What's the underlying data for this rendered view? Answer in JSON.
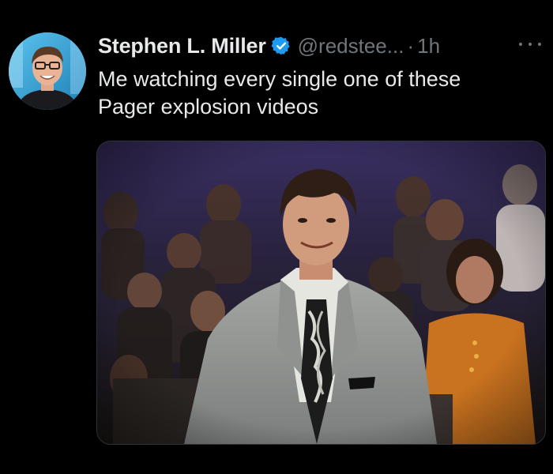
{
  "tweet": {
    "display_name": "Stephen L. Miller",
    "verified_icon": "verified-badge-icon",
    "handle": "@redstee...",
    "separator": "·",
    "timestamp": "1h",
    "more_icon": "more-options-icon",
    "text_lines": [
      "Me watching every single one of these",
      "Pager explosion videos"
    ],
    "media": {
      "type": "video-still",
      "description_icon": "media-image"
    }
  },
  "colors": {
    "background": "#000000",
    "primary_text": "#e7e9ea",
    "secondary_text": "#71767b",
    "verified_blue": "#1d9bf0",
    "border": "#2f3336"
  }
}
